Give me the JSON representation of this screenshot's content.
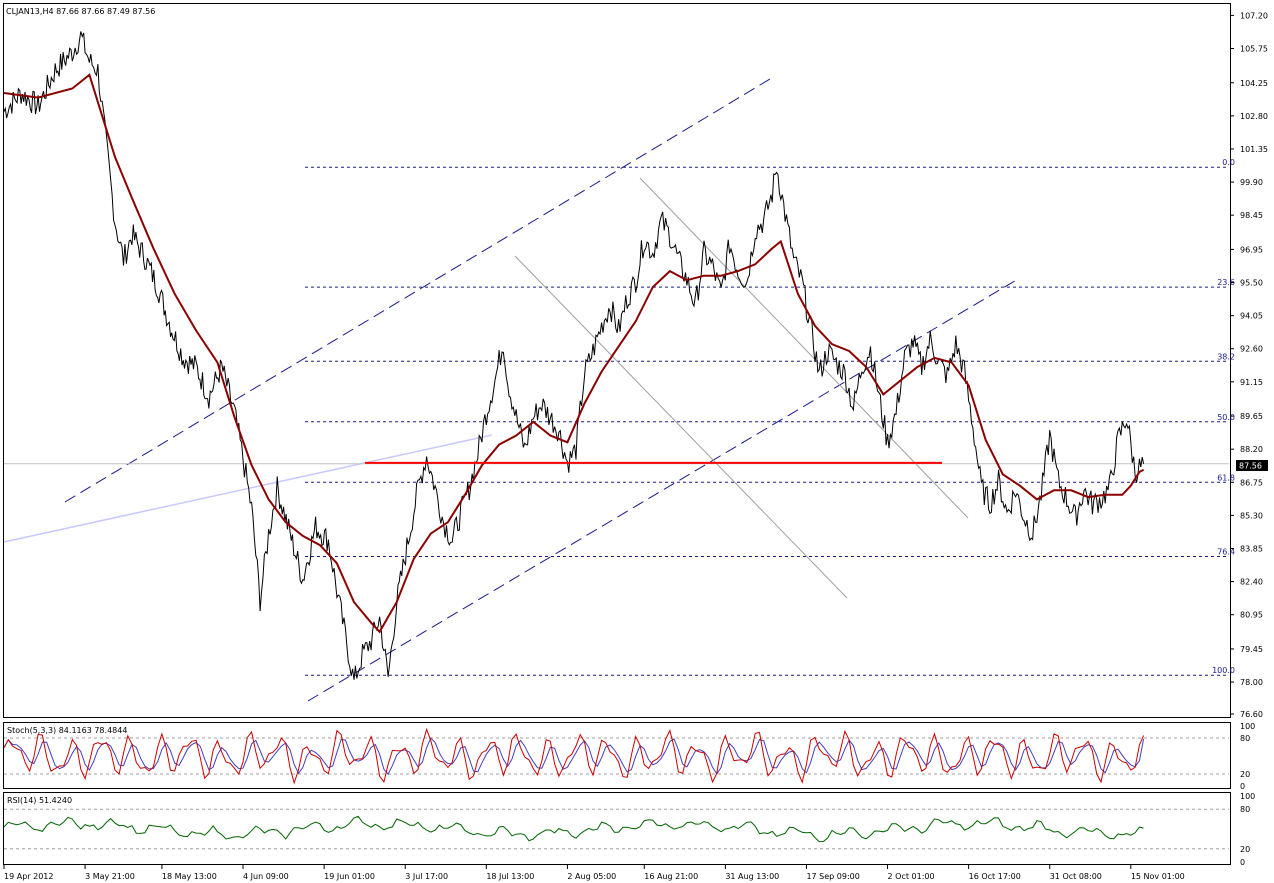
{
  "header": "CLJAN13,H4  87.66 87.66 87.49 87.56",
  "colors": {
    "price": "#000000",
    "ma": "#8b0000",
    "support": "#ff0000",
    "channel": "#1a1a8c",
    "fib": "#1a1a8c",
    "down_channel": "#a0a0a0",
    "trend_light": "#c8c8ff",
    "stoch_main": "#cc0000",
    "stoch_signal": "#4040c0",
    "rsi": "#006400",
    "price_box": "#000000"
  },
  "price_label": "87.56",
  "fib_labels": [
    "0.0",
    "23.6",
    "38.2",
    "50.0",
    "61.8",
    "76.4",
    "100.0"
  ],
  "stoch_label": "Stoch(5,3,3) 84.1163 78.4844",
  "stoch_ticks": [
    "100",
    "80",
    "20",
    "0"
  ],
  "rsi_label": "RSI(14) 51.4240",
  "rsi_ticks": [
    "100",
    "80",
    "20",
    "0"
  ],
  "chart_data": {
    "type": "line",
    "symbol": "CLJAN13",
    "timeframe": "H4",
    "last": 87.56,
    "ylim": [
      76.6,
      107.7
    ],
    "y_ticks": [
      "107.20",
      "105.75",
      "104.25",
      "102.80",
      "101.35",
      "99.90",
      "98.45",
      "96.95",
      "95.50",
      "94.05",
      "92.60",
      "91.15",
      "89.65",
      "88.20",
      "86.75",
      "85.30",
      "83.85",
      "82.40",
      "80.95",
      "79.45",
      "78.00",
      "76.60"
    ],
    "x_labels": [
      "19 Apr 2012",
      "3 May 21:00",
      "18 May 13:00",
      "4 Jun 09:00",
      "19 Jun 01:00",
      "3 Jul 17:00",
      "18 Jul 13:00",
      "2 Aug 05:00",
      "16 Aug 21:00",
      "31 Aug 13:00",
      "17 Sep 09:00",
      "2 Oct 01:00",
      "16 Oct 17:00",
      "31 Oct 08:00",
      "15 Nov 01:00"
    ],
    "price_path": [
      [
        0,
        103.0
      ],
      [
        4,
        103.8
      ],
      [
        8,
        103.2
      ],
      [
        12,
        104.8
      ],
      [
        16,
        105.6
      ],
      [
        18,
        106.3
      ],
      [
        20,
        105.2
      ],
      [
        22,
        104.8
      ],
      [
        24,
        101.5
      ],
      [
        26,
        98.2
      ],
      [
        28,
        96.5
      ],
      [
        30,
        97.6
      ],
      [
        33,
        96.6
      ],
      [
        36,
        95.3
      ],
      [
        39,
        93.6
      ],
      [
        42,
        92.2
      ],
      [
        45,
        91.8
      ],
      [
        48,
        90.5
      ],
      [
        51,
        91.8
      ],
      [
        54,
        89.8
      ],
      [
        56,
        87.8
      ],
      [
        58,
        85.6
      ],
      [
        60,
        81.6
      ],
      [
        62,
        84.5
      ],
      [
        64,
        86.5
      ],
      [
        67,
        84.5
      ],
      [
        70,
        82.5
      ],
      [
        73,
        84.8
      ],
      [
        76,
        84.2
      ],
      [
        78,
        82.0
      ],
      [
        80,
        80.0
      ],
      [
        82,
        78.0
      ],
      [
        84,
        79.2
      ],
      [
        86,
        79.8
      ],
      [
        88,
        80.8
      ],
      [
        90,
        78.2
      ],
      [
        92,
        81.5
      ],
      [
        95,
        84.5
      ],
      [
        97,
        86.5
      ],
      [
        99,
        87.9
      ],
      [
        101,
        86.5
      ],
      [
        103,
        85.0
      ],
      [
        105,
        84.2
      ],
      [
        107,
        85.4
      ],
      [
        109,
        86.5
      ],
      [
        111,
        88.0
      ],
      [
        113,
        89.8
      ],
      [
        115,
        91.2
      ],
      [
        117,
        92.9
      ],
      [
        118,
        91.2
      ],
      [
        120,
        89.6
      ],
      [
        122,
        88.2
      ],
      [
        124,
        89.6
      ],
      [
        126,
        90.2
      ],
      [
        128,
        89.6
      ],
      [
        130,
        89.0
      ],
      [
        132,
        87.6
      ],
      [
        134,
        88.2
      ],
      [
        136,
        91.5
      ],
      [
        138,
        92.5
      ],
      [
        140,
        93.6
      ],
      [
        142,
        94.5
      ],
      [
        144,
        93.4
      ],
      [
        146,
        94.8
      ],
      [
        148,
        95.6
      ],
      [
        150,
        97.4
      ],
      [
        152,
        96.8
      ],
      [
        154,
        98.2
      ],
      [
        156,
        97.6
      ],
      [
        158,
        96.5
      ],
      [
        160,
        95.6
      ],
      [
        162,
        94.5
      ],
      [
        164,
        96.8
      ],
      [
        166,
        96.2
      ],
      [
        168,
        95.0
      ],
      [
        170,
        97.2
      ],
      [
        172,
        96.0
      ],
      [
        174,
        95.5
      ],
      [
        176,
        97.8
      ],
      [
        178,
        98.2
      ],
      [
        180,
        99.4
      ],
      [
        181,
        100.6
      ],
      [
        183,
        98.5
      ],
      [
        185,
        96.5
      ],
      [
        187,
        95.5
      ],
      [
        189,
        93.5
      ],
      [
        191,
        91.5
      ],
      [
        193,
        92.5
      ],
      [
        195,
        92.0
      ],
      [
        197,
        91.5
      ],
      [
        199,
        90.0
      ],
      [
        201,
        91.8
      ],
      [
        203,
        92.6
      ],
      [
        205,
        90.5
      ],
      [
        207,
        88.5
      ],
      [
        209,
        89.8
      ],
      [
        211,
        92.2
      ],
      [
        213,
        92.9
      ],
      [
        215,
        91.8
      ],
      [
        217,
        93.0
      ],
      [
        219,
        92.0
      ],
      [
        221,
        91.4
      ],
      [
        223,
        92.8
      ],
      [
        225,
        91.6
      ],
      [
        227,
        89.2
      ],
      [
        229,
        86.5
      ],
      [
        231,
        85.8
      ],
      [
        233,
        86.8
      ],
      [
        235,
        85.4
      ],
      [
        237,
        86.4
      ],
      [
        239,
        85.2
      ],
      [
        241,
        84.5
      ],
      [
        243,
        86.2
      ],
      [
        245,
        88.8
      ],
      [
        247,
        86.8
      ],
      [
        249,
        86.0
      ],
      [
        251,
        85.2
      ],
      [
        253,
        86.4
      ],
      [
        255,
        85.8
      ],
      [
        257,
        86.0
      ],
      [
        259,
        86.5
      ],
      [
        261,
        88.6
      ],
      [
        263,
        89.6
      ],
      [
        265,
        87.2
      ],
      [
        267,
        87.56
      ]
    ],
    "ma_path": [
      [
        0,
        103.8
      ],
      [
        8,
        103.6
      ],
      [
        16,
        104.0
      ],
      [
        20,
        104.6
      ],
      [
        22,
        103.4
      ],
      [
        26,
        101.0
      ],
      [
        30,
        99.2
      ],
      [
        35,
        97.0
      ],
      [
        40,
        95.0
      ],
      [
        45,
        93.4
      ],
      [
        50,
        92.0
      ],
      [
        54,
        89.6
      ],
      [
        58,
        87.5
      ],
      [
        62,
        86.0
      ],
      [
        66,
        85.0
      ],
      [
        70,
        84.4
      ],
      [
        74,
        84.0
      ],
      [
        78,
        83.2
      ],
      [
        82,
        81.5
      ],
      [
        86,
        80.6
      ],
      [
        88,
        80.2
      ],
      [
        92,
        81.5
      ],
      [
        96,
        83.4
      ],
      [
        100,
        84.5
      ],
      [
        104,
        85.0
      ],
      [
        108,
        86.2
      ],
      [
        112,
        87.5
      ],
      [
        116,
        88.4
      ],
      [
        120,
        88.8
      ],
      [
        124,
        89.4
      ],
      [
        128,
        88.8
      ],
      [
        132,
        88.5
      ],
      [
        136,
        90.2
      ],
      [
        140,
        91.6
      ],
      [
        144,
        92.7
      ],
      [
        148,
        93.8
      ],
      [
        152,
        95.3
      ],
      [
        156,
        96.0
      ],
      [
        160,
        95.6
      ],
      [
        164,
        95.8
      ],
      [
        168,
        95.8
      ],
      [
        172,
        96.0
      ],
      [
        176,
        96.3
      ],
      [
        180,
        97.0
      ],
      [
        182,
        97.3
      ],
      [
        186,
        95.0
      ],
      [
        190,
        93.6
      ],
      [
        194,
        92.8
      ],
      [
        198,
        92.5
      ],
      [
        202,
        91.8
      ],
      [
        206,
        90.6
      ],
      [
        210,
        91.2
      ],
      [
        214,
        91.8
      ],
      [
        218,
        92.2
      ],
      [
        222,
        92.0
      ],
      [
        226,
        91.0
      ],
      [
        230,
        88.6
      ],
      [
        234,
        87.1
      ],
      [
        238,
        86.6
      ],
      [
        242,
        86.0
      ],
      [
        246,
        86.4
      ],
      [
        250,
        86.4
      ],
      [
        254,
        86.1
      ],
      [
        258,
        86.2
      ],
      [
        262,
        86.2
      ],
      [
        264,
        86.6
      ],
      [
        266,
        87.2
      ],
      [
        267,
        87.3
      ]
    ],
    "fibonacci": [
      {
        "level": "0.0",
        "price": 100.55
      },
      {
        "level": "23.6",
        "price": 95.3
      },
      {
        "level": "38.2",
        "price": 92.05
      },
      {
        "level": "50.0",
        "price": 89.4
      },
      {
        "level": "61.8",
        "price": 86.75
      },
      {
        "level": "76.4",
        "price": 83.5
      },
      {
        "level": "100.0",
        "price": 78.3
      }
    ],
    "support_level": 87.6,
    "stoch": {
      "main": 84.1163,
      "signal": 78.4844,
      "levels": [
        80,
        20
      ],
      "range": [
        0,
        100
      ]
    },
    "rsi": {
      "value": 51.424,
      "levels": [
        80,
        20
      ],
      "range": [
        0,
        100
      ]
    }
  }
}
